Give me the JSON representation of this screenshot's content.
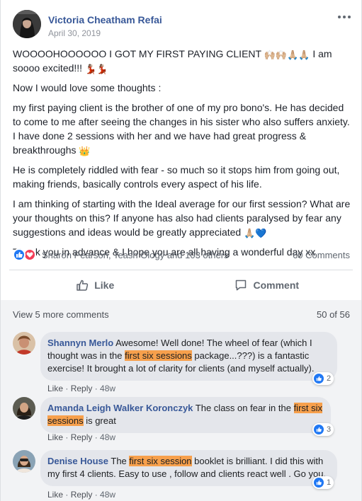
{
  "post": {
    "author": "Victoria Cheatham Refai",
    "date": "April 30, 2019",
    "p1": "WOOOOHOOOOOO I GOT MY FIRST PAYING CLIENT",
    "p1_emoji": "🙌🏼🙌🏼🙏🏼🙏🏼",
    "p1b": "I am soooo excited!!!",
    "p1b_emoji": "💃🏽💃🏽",
    "p2": "Now I would love some thoughts :",
    "p3": "my first paying client is the brother of one of my pro bono's. He has decided to come to me after seeing the changes in his sister who also suffers anxiety. I have done 2 sessions with her and we have had great progress & breakthroughs",
    "p3_emoji": "👑",
    "p4": "He is completely riddled with fear - so much so it stops him from going out, making friends, basically controls every aspect of his life.",
    "p5": "I am thinking of starting with the Ideal average for our first session? What are your thoughts on this? If anyone has also had clients paralysed by fear any suggestions and ideas would be greatly appreciated",
    "p5_emoji": "🙏🏼💙",
    "p6": "Thank you in advance & I hope you are all having a wonderful day xx"
  },
  "reactions": {
    "names": "Sharon Pearson, Teash Ology and 103 others",
    "comments_count": "60 Comments"
  },
  "actions": {
    "like": "Like",
    "comment": "Comment"
  },
  "comments_header": {
    "view_more": "View 5 more comments",
    "pager": "50 of 56"
  },
  "comments": [
    {
      "name": "Shannyn Merlo",
      "text_a": "Awesome! Well done! The wheel of fear (which I thought was in the",
      "highlight": "first six sessions",
      "text_b": "package...???) is a fantastic exercise! It brought a lot of clarity for clients (and myself actually).",
      "like": "Like",
      "reply": "Reply",
      "time": "48w",
      "reactions": "2"
    },
    {
      "name": "Amanda Leigh Walker Koronczyk",
      "text_a": "The class on fear in the",
      "highlight1": "first six",
      "highlight2": "sessions",
      "text_b": "is great",
      "like": "Like",
      "reply": "Reply",
      "time": "48w",
      "reactions": "3"
    },
    {
      "name": "Denise House",
      "text_a": "The",
      "highlight": "first six session",
      "text_b": "booklet is brilliant. I did this with my first 4 clients. Easy to use , follow and clients react well . Go you.",
      "like": "Like",
      "reply": "Reply",
      "time": "48w",
      "reactions": "1"
    }
  ],
  "colors": {
    "link": "#385898",
    "highlight": "#f7a04c",
    "like_blue": "#2078f4",
    "love_red": "#f33e58"
  }
}
